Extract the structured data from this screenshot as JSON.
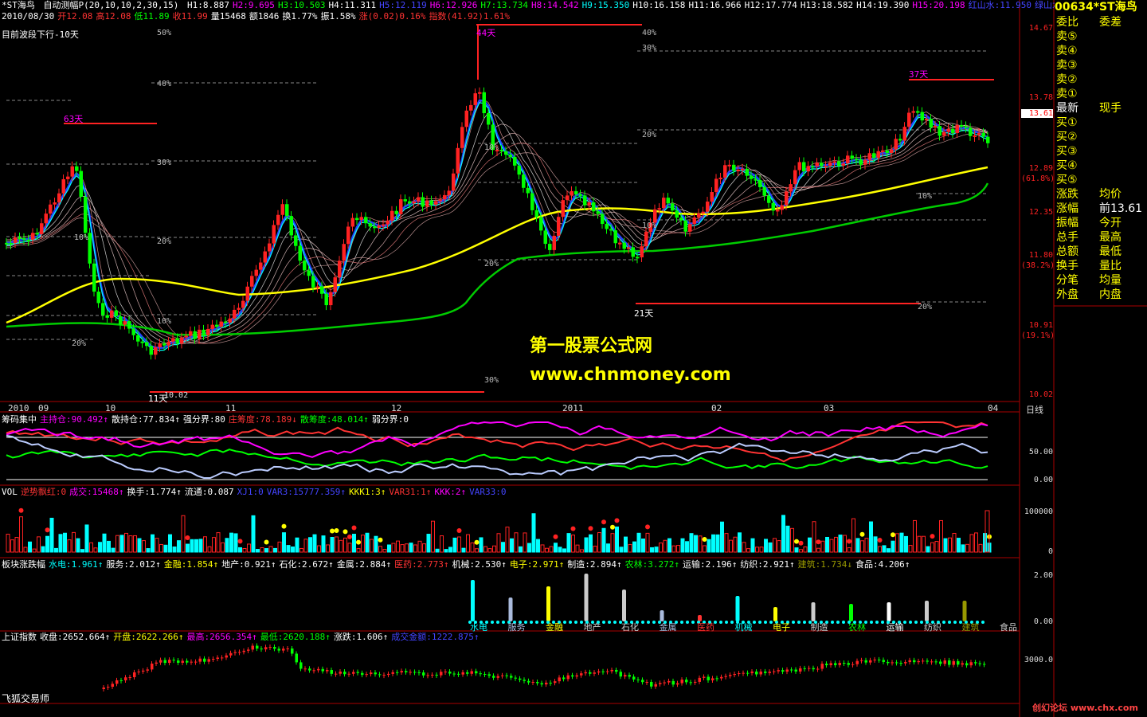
{
  "header": {
    "title": "*ST海鸟",
    "formula": "自动测幅P(20,10,10,2,30,15)",
    "h_values": [
      {
        "label": "H1:8.887",
        "color": "#ffffff"
      },
      {
        "label": "H2:9.695",
        "color": "#ff00ff"
      },
      {
        "label": "H3:10.503",
        "color": "#00ff00"
      },
      {
        "label": "H4:11.311",
        "color": "#ffffff"
      },
      {
        "label": "H5:12.119",
        "color": "#4444ff"
      },
      {
        "label": "H6:12.926",
        "color": "#ff00ff"
      },
      {
        "label": "H7:13.734",
        "color": "#00ff00"
      },
      {
        "label": "H8:14.542",
        "color": "#ff00ff"
      },
      {
        "label": "H9:15.350",
        "color": "#00ffff"
      },
      {
        "label": "H10:16.158",
        "color": "#ffffff"
      },
      {
        "label": "H11:16.966",
        "color": "#ffffff"
      },
      {
        "label": "H12:17.774",
        "color": "#ffffff"
      },
      {
        "label": "H13:18.582",
        "color": "#ffffff"
      },
      {
        "label": "H14:19.390",
        "color": "#ffffff"
      },
      {
        "label": "H15:20.198",
        "color": "#ff00ff"
      },
      {
        "label": "红山水:11.950",
        "color": "#4444ff"
      },
      {
        "label": "绿山水:",
        "color": "#4444ff"
      }
    ],
    "row2": [
      {
        "label": "2010/08/30",
        "color": "#ffffff"
      },
      {
        "label": "开12.08",
        "color": "#ff3333"
      },
      {
        "label": "高12.08",
        "color": "#ff3333"
      },
      {
        "label": "低11.89",
        "color": "#00ff00"
      },
      {
        "label": "收11.99",
        "color": "#ff3333"
      },
      {
        "label": "量15468",
        "color": "#ffffff"
      },
      {
        "label": "额1846",
        "color": "#ffffff"
      },
      {
        "label": "换1.77%",
        "color": "#ffffff"
      },
      {
        "label": "振1.58%",
        "color": "#ffffff"
      },
      {
        "label": "涨(0.02)0.16%",
        "color": "#ff3333"
      },
      {
        "label": "指数(41.92)1.61%",
        "color": "#ff3333"
      }
    ],
    "subtitle": "目前波段下行-10天"
  },
  "main_chart": {
    "y_axis_labels": [
      "14.67",
      "13.78",
      "13.61",
      "12.89",
      "(61.8%)",
      "12.35",
      "11.80",
      "(38.2%)",
      "10.91",
      "(19.1%)",
      "10.02"
    ],
    "pct_labels": [
      "50%",
      "40%",
      "30%",
      "20%",
      "10%",
      "20%",
      "10%",
      "30%",
      "20%",
      "10%",
      "40%",
      "30%",
      "20%",
      "10%",
      "20%",
      "10%",
      "30%",
      "20%",
      "20%",
      "10%"
    ],
    "day_labels": [
      "63天",
      "44天",
      "37天",
      "21天",
      "11天"
    ],
    "low_label": "10.02",
    "x_ticks": [
      "2010",
      "09",
      "10",
      "11",
      "12",
      "2011",
      "02",
      "03",
      "04"
    ],
    "period": "日线",
    "watermark_title": "第一股票公式网",
    "watermark_url": "www.chnmoney.com"
  },
  "panel_chip": {
    "items": [
      {
        "label": "筹码集中",
        "color": "#ffffff"
      },
      {
        "label": "主持仓:90.492↑",
        "color": "#ff00ff"
      },
      {
        "label": "散持仓:77.834↑",
        "color": "#ffffff"
      },
      {
        "label": "强分界:80",
        "color": "#ffffff"
      },
      {
        "label": "庄筹度:78.189↓",
        "color": "#ff3333"
      },
      {
        "label": "散筹度:48.014↑",
        "color": "#00ff00"
      },
      {
        "label": "弱分界:0",
        "color": "#ffffff"
      }
    ],
    "axis": [
      "50.00",
      "0.00"
    ]
  },
  "panel_vol": {
    "items": [
      {
        "label": "VOL",
        "color": "#ffffff"
      },
      {
        "label": "逆势飘红:0",
        "color": "#ff3333"
      },
      {
        "label": "成交:15468↑",
        "color": "#ff00ff"
      },
      {
        "label": "换手:1.774↑",
        "color": "#ffffff"
      },
      {
        "label": "流通:0.087",
        "color": "#ffffff"
      },
      {
        "label": "XJ1:0",
        "color": "#4444ff"
      },
      {
        "label": "VAR3:15777.359↑",
        "color": "#4444ff"
      },
      {
        "label": "KKK1:3↑",
        "color": "#ffff00"
      },
      {
        "label": "VAR31:1↑",
        "color": "#ff3333"
      },
      {
        "label": "KKK:2↑",
        "color": "#ff00ff"
      },
      {
        "label": "VAR33:0",
        "color": "#4444ff"
      }
    ],
    "axis": [
      "100000",
      "0"
    ]
  },
  "panel_sector": {
    "items": [
      {
        "label": "板块涨跌幅",
        "color": "#ffffff"
      },
      {
        "label": "水电:1.961↑",
        "color": "#00ffff"
      },
      {
        "label": "服务:2.012↑",
        "color": "#ffffff"
      },
      {
        "label": "金融:1.854↑",
        "color": "#ffff00"
      },
      {
        "label": "地产:0.921↑",
        "color": "#ffffff"
      },
      {
        "label": "石化:2.672↑",
        "color": "#ffffff"
      },
      {
        "label": "金属:2.884↑",
        "color": "#ffffff"
      },
      {
        "label": "医药:2.773↑",
        "color": "#ff3333"
      },
      {
        "label": "机械:2.530↑",
        "color": "#ffffff"
      },
      {
        "label": "电子:2.971↑",
        "color": "#ffff00"
      },
      {
        "label": "制造:2.894↑",
        "color": "#ffffff"
      },
      {
        "label": "农林:3.272↑",
        "color": "#00ff00"
      },
      {
        "label": "运输:2.196↑",
        "color": "#ffffff"
      },
      {
        "label": "纺织:2.921↑",
        "color": "#ffffff"
      },
      {
        "label": "建筑:1.734↓",
        "color": "#999900"
      },
      {
        "label": "食品:4.206↑",
        "color": "#ffffff"
      }
    ],
    "bar_labels": [
      "水电",
      "服务",
      "金融",
      "地产",
      "石化",
      "金属",
      "医药",
      "机械",
      "电子",
      "制造",
      "农林",
      "运输",
      "纺织",
      "建筑",
      "食品"
    ],
    "axis": [
      "2.00",
      "0.00"
    ]
  },
  "panel_index": {
    "items": [
      {
        "label": "上证指数",
        "color": "#ffffff"
      },
      {
        "label": "收盘:2652.664↑",
        "color": "#ffffff"
      },
      {
        "label": "开盘:2622.266↑",
        "color": "#ffff00"
      },
      {
        "label": "最高:2656.354↑",
        "color": "#ff00ff"
      },
      {
        "label": "最低:2620.188↑",
        "color": "#00ff00"
      },
      {
        "label": "涨跌:1.606↑",
        "color": "#ffffff"
      },
      {
        "label": "成交金额:1222.875↑",
        "color": "#4444ff"
      }
    ],
    "axis": [
      "3000.0"
    ],
    "bottom_left": "飞狐交易师",
    "bottom_right": "创幻论坛 www.chx.com"
  },
  "side_panel": {
    "code": "00634",
    "name": "*ST海鸟",
    "rows": [
      {
        "l": "委比",
        "r": "委差"
      },
      {
        "l": "卖⑤",
        "r": ""
      },
      {
        "l": "卖④",
        "r": ""
      },
      {
        "l": "卖③",
        "r": ""
      },
      {
        "l": "卖②",
        "r": ""
      },
      {
        "l": "卖①",
        "r": ""
      },
      {
        "l": "最新",
        "r": "现手"
      },
      {
        "l": "买①",
        "r": ""
      },
      {
        "l": "买②",
        "r": ""
      },
      {
        "l": "买③",
        "r": ""
      },
      {
        "l": "买④",
        "r": ""
      },
      {
        "l": "买⑤",
        "r": ""
      },
      {
        "l": "涨跌",
        "r": "均价"
      },
      {
        "l": "涨幅",
        "r": "前13.61"
      },
      {
        "l": "振幅",
        "r": "今开"
      },
      {
        "l": "总手",
        "r": "最高"
      },
      {
        "l": "总额",
        "r": "最低"
      },
      {
        "l": "换手",
        "r": "量比"
      },
      {
        "l": "分笔",
        "r": "均量"
      },
      {
        "l": "外盘",
        "r": "内盘"
      }
    ]
  },
  "colors": {
    "up": "#ff2222",
    "down": "#00ff00",
    "cyan": "#00ffff",
    "yellow": "#ffff00",
    "grid": "#aa0000"
  }
}
